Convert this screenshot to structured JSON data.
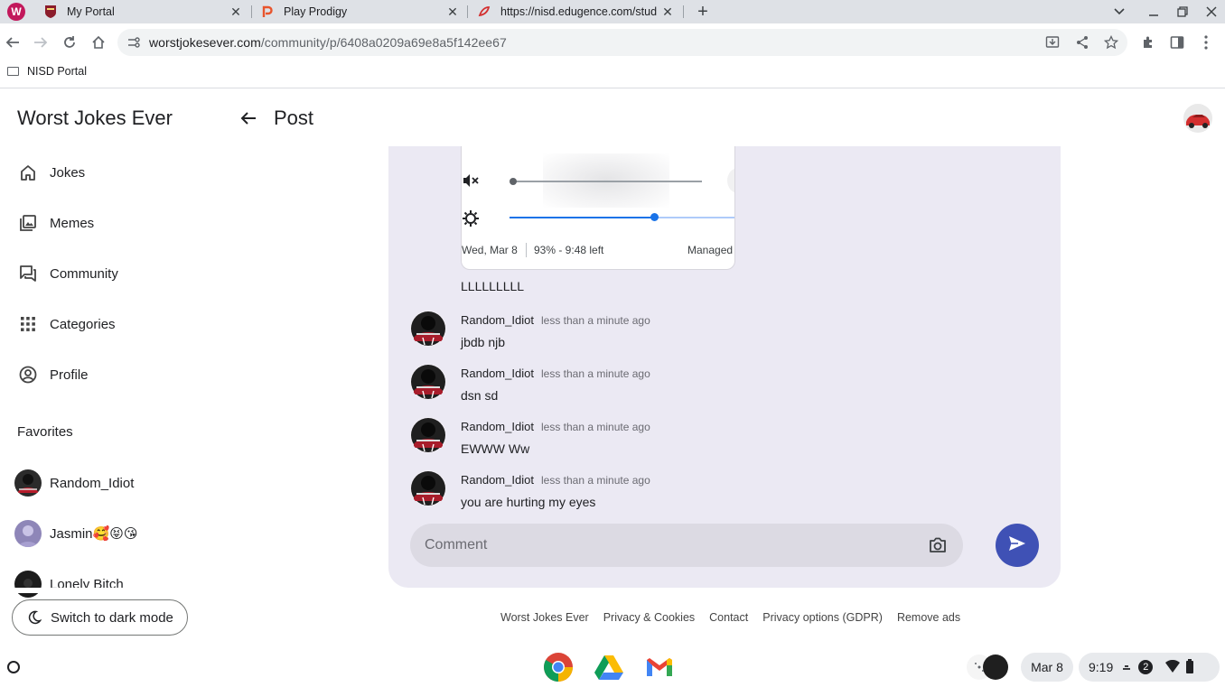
{
  "browser": {
    "tabs": [
      {
        "title": "My Portal",
        "favicon": "school-crest-icon"
      },
      {
        "title": "Play Prodigy",
        "favicon": "prodigy-icon"
      },
      {
        "title": "https://nisd.edugence.com/stud",
        "favicon": "edugence-icon"
      }
    ],
    "profile_letter": "W",
    "url_host": "worstjokesever.com",
    "url_path": "/community/p/6408a0209a69e8a5f142ee67",
    "bookmarks": [
      {
        "label": "NISD Portal"
      }
    ]
  },
  "sidebar": {
    "site_title": "Worst Jokes Ever",
    "nav": [
      {
        "label": "Jokes",
        "icon": "home-icon"
      },
      {
        "label": "Memes",
        "icon": "image-icon"
      },
      {
        "label": "Community",
        "icon": "forum-icon"
      },
      {
        "label": "Categories",
        "icon": "grid-icon"
      },
      {
        "label": "Profile",
        "icon": "account-icon"
      }
    ],
    "favorites_heading": "Favorites",
    "favorites": [
      {
        "name": "Random_Idiot"
      },
      {
        "name": "Jasmin🥰😝😘"
      },
      {
        "name": "Lonely Bitch"
      }
    ],
    "dark_mode_label": "Switch to dark mode"
  },
  "header": {
    "title": "Post"
  },
  "post": {
    "screenshot": {
      "date": "Wed, Mar 8",
      "battery": "93% - 9:48 left",
      "managed": "Managed",
      "volume_level": 0.0,
      "brightness_level": 0.7
    },
    "text": "LLLLLLLLL"
  },
  "comments": [
    {
      "author": "Random_Idiot",
      "time": "less than a minute ago",
      "text": "jbdb njb"
    },
    {
      "author": "Random_Idiot",
      "time": "less than a minute ago",
      "text": "dsn sd"
    },
    {
      "author": "Random_Idiot",
      "time": "less than a minute ago",
      "text": "EWWW Ww"
    },
    {
      "author": "Random_Idiot",
      "time": "less than a minute ago",
      "text": "you are hurting my eyes"
    }
  ],
  "comment_input": {
    "placeholder": "Comment"
  },
  "footer": {
    "links": [
      "Worst Jokes Ever",
      "Privacy & Cookies",
      "Contact",
      "Privacy options (GDPR)",
      "Remove ads"
    ]
  },
  "shelf": {
    "apps": [
      "chrome-icon",
      "drive-icon",
      "gmail-icon"
    ],
    "date": "Mar 8",
    "time": "9:19",
    "notification_count": "2"
  },
  "colors": {
    "accent": "#3f51b5",
    "card_bg": "#ebe9f3",
    "tabstrip": "#dee1e6"
  }
}
